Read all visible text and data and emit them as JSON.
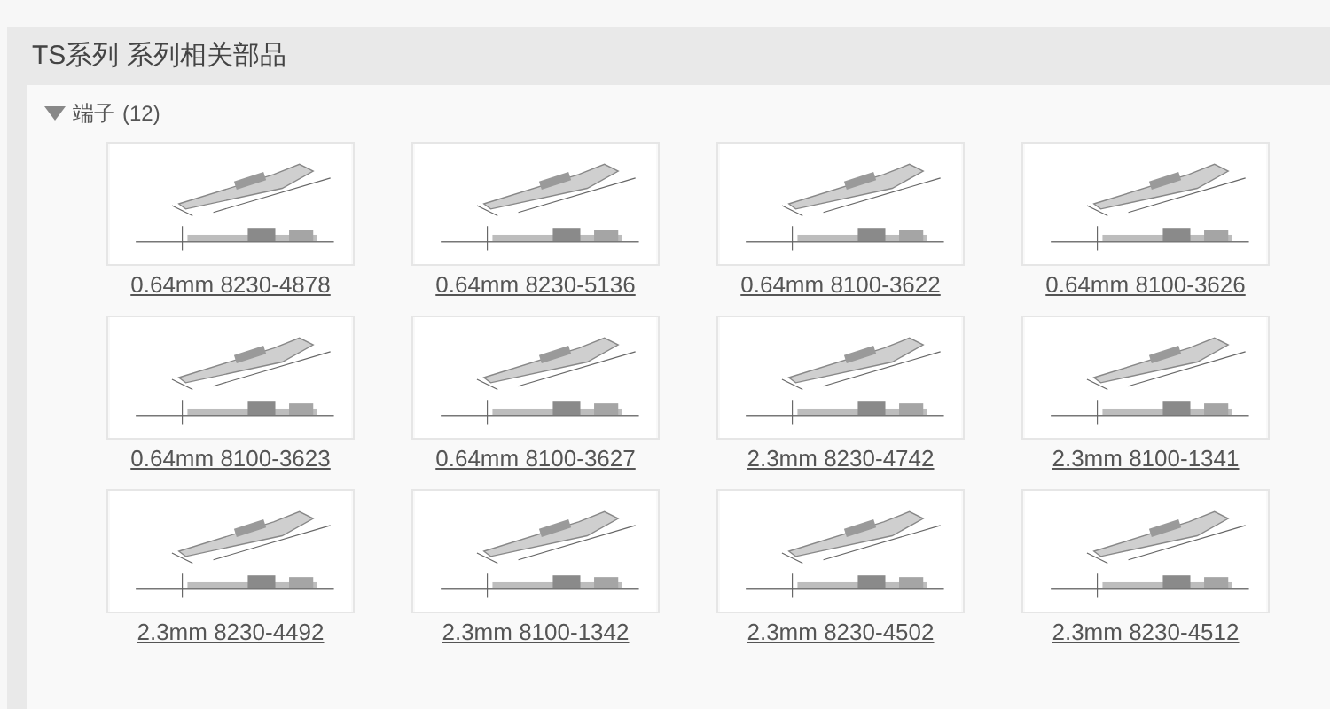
{
  "panel": {
    "title": "TS系列 系列相关部品"
  },
  "section": {
    "label": "端子",
    "count": "(12)",
    "expanded": true,
    "items": [
      {
        "kind": "picture",
        "caption": "0.64mm 8230-4878"
      },
      {
        "kind": "picture",
        "caption": "0.64mm 8230-5136"
      },
      {
        "kind": "picture",
        "caption": "0.64mm 8100-3622"
      },
      {
        "kind": "picture",
        "caption": "0.64mm 8100-3626"
      },
      {
        "kind": "picture",
        "caption": "0.64mm 8100-3623"
      },
      {
        "kind": "picture",
        "caption": "0.64mm 8100-3627"
      },
      {
        "kind": "picture",
        "caption": "2.3mm 8230-4742"
      },
      {
        "kind": "picture",
        "caption": "2.3mm 8100-1341"
      },
      {
        "kind": "picture",
        "caption": "2.3mm 8230-4492"
      },
      {
        "kind": "picture",
        "caption": "2.3mm 8100-1342"
      },
      {
        "kind": "picture",
        "caption": "2.3mm 8230-4502"
      },
      {
        "kind": "picture",
        "caption": "2.3mm 8230-4512"
      }
    ]
  }
}
